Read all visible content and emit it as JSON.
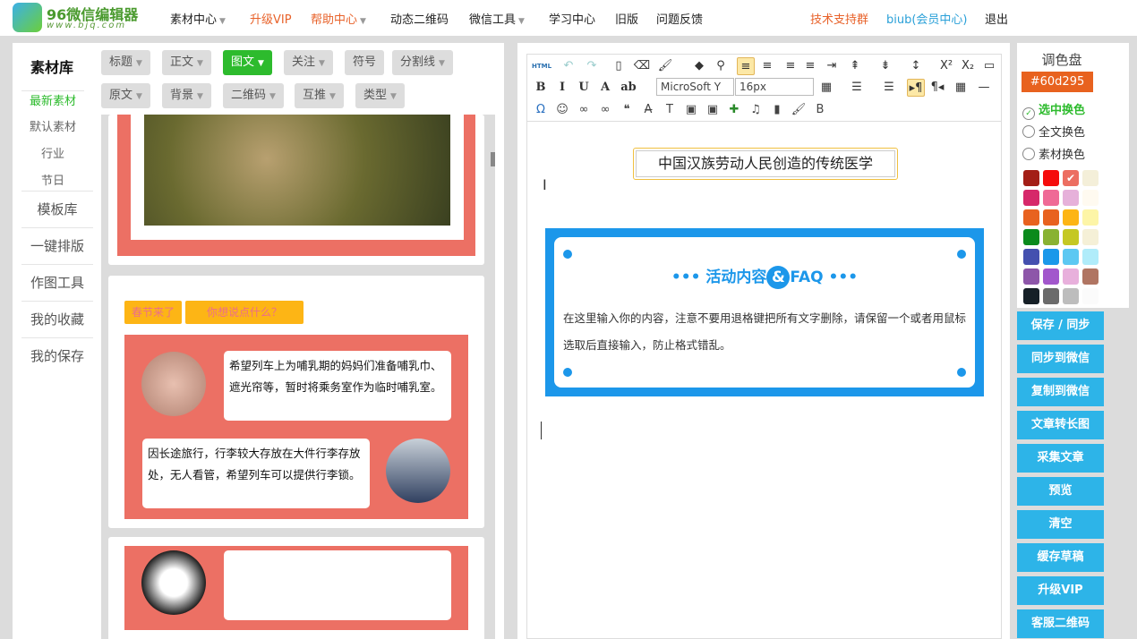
{
  "header": {
    "logo_title": "96微信编辑器",
    "logo_url": "www.bjq.com",
    "nav": [
      {
        "label": "素材中心",
        "caret": true,
        "color": "#222"
      },
      {
        "label": "升级VIP",
        "caret": false,
        "color": "#e8622a"
      },
      {
        "label": "帮助中心",
        "caret": true,
        "color": "#e8622a"
      },
      {
        "label": "动态二维码",
        "caret": false,
        "color": "#222"
      },
      {
        "label": "微信工具",
        "caret": true,
        "color": "#222"
      },
      {
        "label": "学习中心",
        "caret": false,
        "color": "#222"
      },
      {
        "label": "旧版",
        "caret": false,
        "color": "#222"
      },
      {
        "label": "问题反馈",
        "caret": false,
        "color": "#222"
      }
    ],
    "support": "技术支持群",
    "member": "biub(会员中心)",
    "logout": "退出"
  },
  "sidebar": {
    "title": "素材库",
    "subs": [
      "最新素材",
      "默认素材",
      "行业",
      "节日"
    ],
    "mains": [
      "模板库",
      "一键排版",
      "作图工具",
      "我的收藏",
      "我的保存"
    ]
  },
  "categories": {
    "row1": [
      "标题",
      "正文",
      "图文",
      "关注",
      "符号",
      "分割线"
    ],
    "row2": [
      "原文",
      "背景",
      "二维码",
      "互推",
      "类型"
    ],
    "active": "图文",
    "no_caret": [
      "符号"
    ]
  },
  "materials": {
    "tag1": "春节来了",
    "tag2": "你想说点什么？",
    "bubble1": "希望列车上为哺乳期的妈妈们准备哺乳巾、遮光帘等，暂时将乘务室作为临时哺乳室。",
    "bubble2": "因长途旅行，行李较大存放在大件行李存放处，无人看管，希望列车可以提供行李锁。"
  },
  "toolbar": {
    "html": "HTML",
    "font": "MicroSoft Y",
    "size": "16px"
  },
  "editor": {
    "title_box": "中国汉族劳动人民创造的传统医学",
    "faq_title": "活动内容",
    "faq_amp": "&",
    "faq_suffix": "FAQ",
    "faq_body": "在这里输入你的内容，注意不要用退格键把所有文字删除，请保留一个或者用鼠标选取后直接输入，防止格式错乱。"
  },
  "palette": {
    "title": "调色盘",
    "current": "#60d295",
    "options": [
      "选中换色",
      "全文换色",
      "素材换色"
    ],
    "selected": "选中换色",
    "colors": [
      "#a31e16",
      "#f50c0c",
      "#ec6e61",
      "#f4efd9",
      "#d6286a",
      "#ef6a96",
      "#e6b1da",
      "#fffaf0",
      "#e8621f",
      "#e8621f",
      "#fdb515",
      "#fdf5a7",
      "#0b8a1c",
      "#89b232",
      "#c5c823",
      "#f5f0d7",
      "#4450af",
      "#1a98ea",
      "#5cc8f2",
      "#b0ecfa",
      "#8d56a9",
      "#a257cc",
      "#e8b0dc",
      "#b07562",
      "#162027",
      "#6b6b6b",
      "#bdbdbd",
      "#fbfbfb"
    ]
  },
  "actions": [
    "保存 / 同步",
    "同步到微信",
    "复制到微信",
    "文章转长图",
    "采集文章",
    "预览",
    "清空",
    "缓存草稿",
    "升级VIP",
    "客服二维码"
  ]
}
